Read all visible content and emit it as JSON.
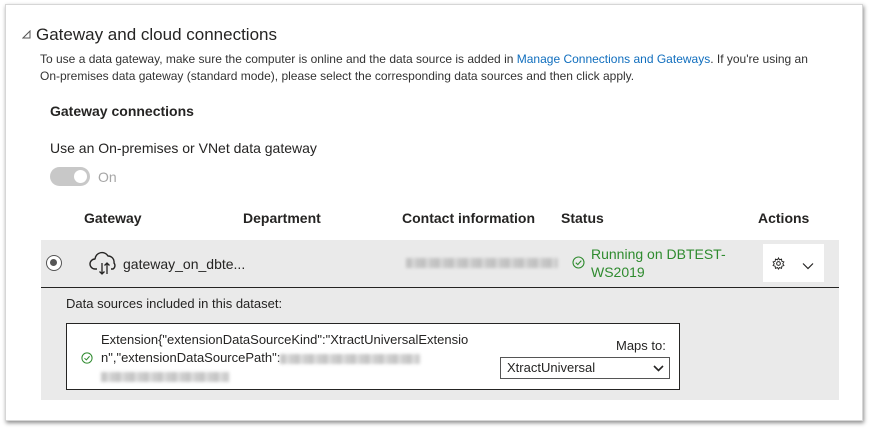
{
  "section": {
    "title": "Gateway and cloud connections",
    "description_pre": "To use a data gateway, make sure the computer is online and the data source is added in ",
    "description_link": "Manage Connections and Gateways",
    "description_post": ". If you're using an On-premises data gateway (standard mode), please select the corresponding data sources and then click apply."
  },
  "gateway_connections": {
    "heading": "Gateway connections",
    "toggle_label": "Use an On-premises or VNet data gateway",
    "toggle_state": "On",
    "toggle_on": true
  },
  "table": {
    "columns": [
      "Gateway",
      "Department",
      "Contact information",
      "Status",
      "Actions"
    ],
    "row": {
      "selected": true,
      "gateway": "gateway_on_dbte...",
      "department": "",
      "status": "Running on DBTEST-WS2019"
    }
  },
  "data_sources": {
    "label": "Data sources included in this dataset:",
    "entry_text": "Extension{\"extensionDataSourceKind\":\"XtractUniversalExtension\",\"extensionDataSourcePath\":",
    "maps_to_label": "Maps to:",
    "maps_to_value": "XtractUniversal"
  },
  "colors": {
    "status_green": "#2f8b2f",
    "link_blue": "#106ebe",
    "panel_gray": "#eaeaea"
  },
  "icons": [
    "collapse-triangle-icon",
    "cloud-gateway-icon",
    "check-circle-icon",
    "gear-icon",
    "chevron-down-icon"
  ]
}
